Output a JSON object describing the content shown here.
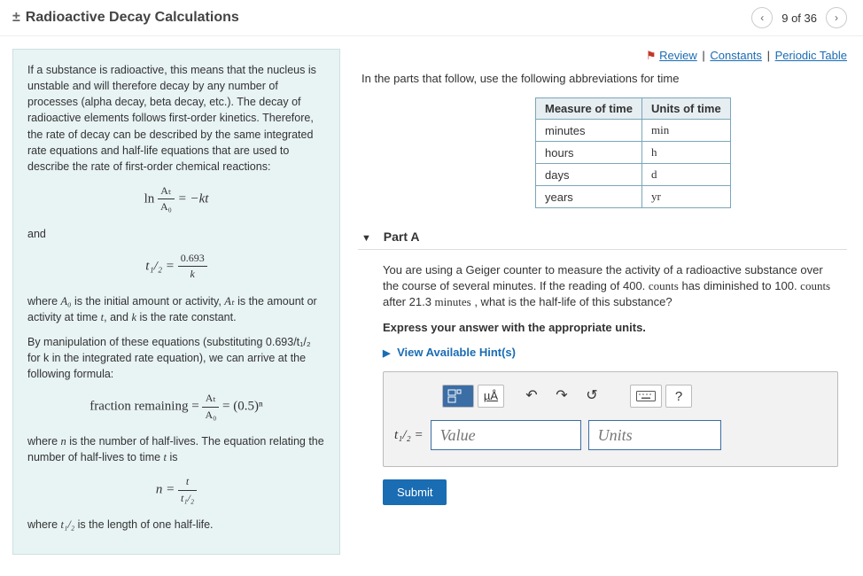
{
  "header": {
    "plus_minus": "±",
    "title": "Radioactive Decay Calculations",
    "prev": "‹",
    "next": "›",
    "counter": "9 of 36"
  },
  "links": {
    "flag": "⚑",
    "review": "Review",
    "constants": "Constants",
    "periodic": "Periodic Table",
    "sep": "|"
  },
  "left": {
    "p1": "If a substance is radioactive, this means that the nucleus is unstable and will therefore decay by any number of processes (alpha decay, beta decay, etc.). The decay of radioactive elements follows first-order kinetics. Therefore, the rate of decay can be described by the same integrated rate equations and half-life equations that are used to describe the rate of first-order chemical reactions:",
    "eq1_ln": "ln",
    "eq1_num": "Aₜ",
    "eq1_den": "A₀",
    "eq1_eq": " = −kt",
    "and": "and",
    "eq2_left": "t₁/₂ = ",
    "eq2_num": "0.693",
    "eq2_den": "k",
    "p2a": "where ",
    "p2b": " is the initial amount or activity, ",
    "p2c": " is the amount or activity at time ",
    "p2d": ", and ",
    "p2e": " is the rate constant.",
    "A0": "A₀",
    "At": "Aₜ",
    "t": "t",
    "k": "k",
    "p3": "By manipulation of these equations (substituting 0.693/t₁/₂ for k in the integrated rate equation), we can arrive at the following formula:",
    "eq3_left": "fraction remaining = ",
    "eq3_num": "Aₜ",
    "eq3_den": "A₀",
    "eq3_right": " = (0.5)ⁿ",
    "p4a": "where ",
    "p4b": " is the number of half-lives.  The equation relating the number of half-lives to time ",
    "p4c": " is",
    "n": "n",
    "eq4_left": "n = ",
    "eq4_num": "t",
    "eq4_den": "t₁/₂",
    "p5a": "where ",
    "p5b": " is the length of one half-life.",
    "t12": "t₁/₂"
  },
  "right": {
    "intro": "In the parts that follow, use the following abbreviations for time",
    "table": {
      "h1": "Measure of time",
      "h2": "Units of time",
      "rows": [
        {
          "m": "minutes",
          "u": "min"
        },
        {
          "m": "hours",
          "u": "h"
        },
        {
          "m": "days",
          "u": "d"
        },
        {
          "m": "years",
          "u": "yr"
        }
      ]
    },
    "partA": {
      "label": "Part A",
      "q1": "You are using a Geiger counter to measure the activity of a radioactive substance over the course of several minutes. If the reading of 400. ",
      "q1b": " has diminished to 100. ",
      "q1c": " after 21.3 ",
      "q1d": " , what is the half-life of this substance?",
      "counts": "counts",
      "minutes": "minutes",
      "instr": "Express your answer with the appropriate units.",
      "hint": "View Available Hint(s)",
      "tool_ua": "µÅ",
      "tool_undo": "↶",
      "tool_redo": "↷",
      "tool_reset": "↺",
      "tool_help": "?",
      "lbl": "t₁/₂ =",
      "val_ph": "Value",
      "unit_ph": "Units",
      "submit": "Submit"
    }
  }
}
